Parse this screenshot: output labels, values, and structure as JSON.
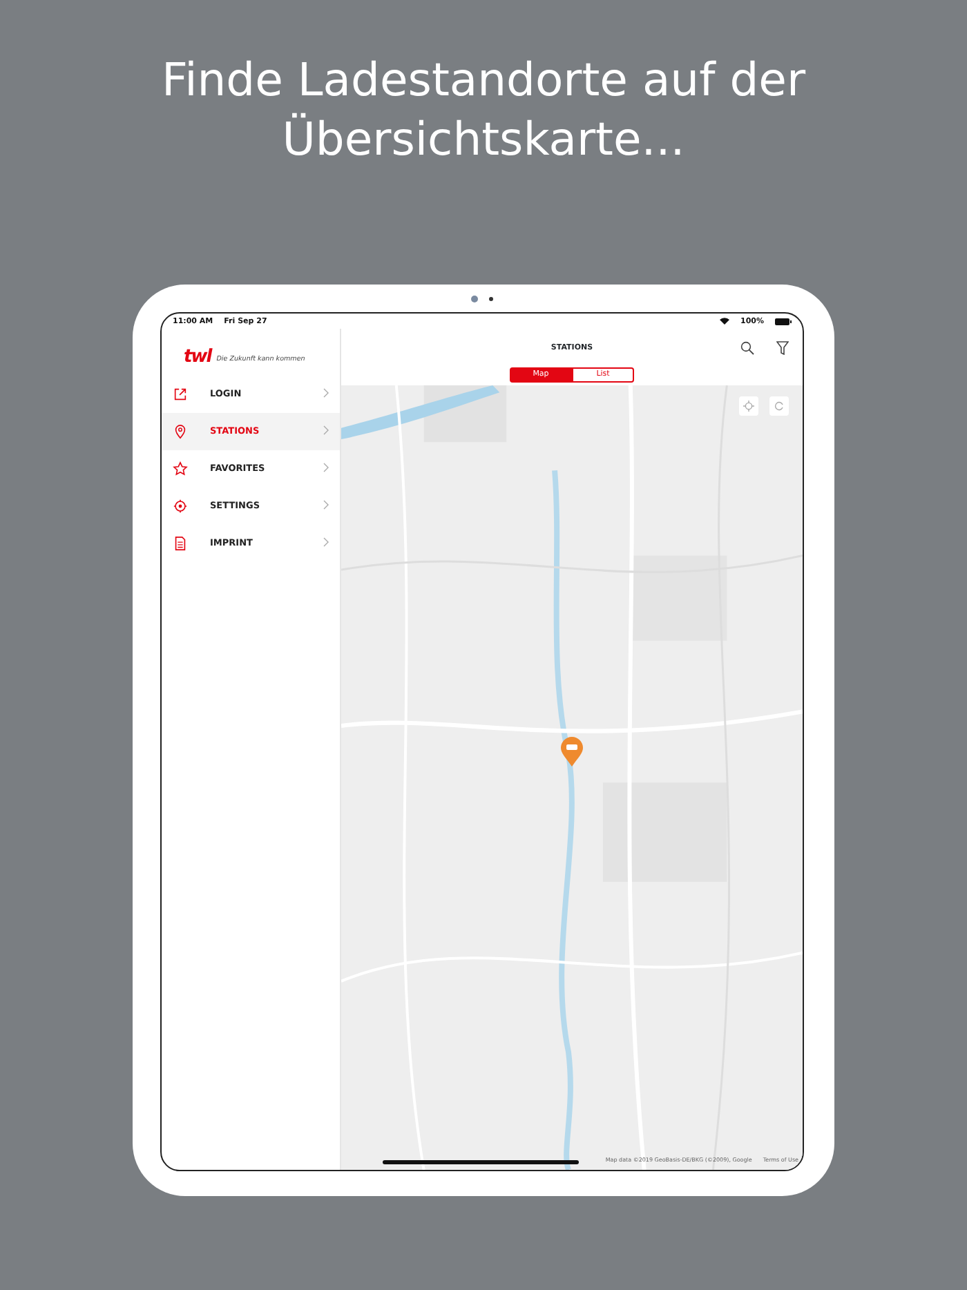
{
  "headline": [
    "Finde Ladestandorte auf der",
    "Übersichtskarte..."
  ],
  "status_bar": {
    "time": "11:00 AM",
    "date": "Fri Sep 27",
    "battery": "100%"
  },
  "sidebar": {
    "logo": "twl",
    "tagline": "Die Zukunft kann kommen",
    "items": [
      {
        "label": "LOGIN",
        "kind": "login",
        "selected": false
      },
      {
        "label": "STATIONS",
        "kind": "pin",
        "selected": true
      },
      {
        "label": "FAVORITES",
        "kind": "star",
        "selected": false
      },
      {
        "label": "SETTINGS",
        "kind": "gear",
        "selected": false
      },
      {
        "label": "IMPRINT",
        "kind": "doc",
        "selected": false
      }
    ]
  },
  "header": {
    "title": "STATIONS"
  },
  "segments": [
    {
      "label": "Map",
      "selected": true
    },
    {
      "label": "List",
      "selected": false
    }
  ],
  "map": {
    "attribution": "Map data ©2019 GeoBasis-DE/BKG (©2009), Google",
    "terms": "Terms of Use"
  }
}
